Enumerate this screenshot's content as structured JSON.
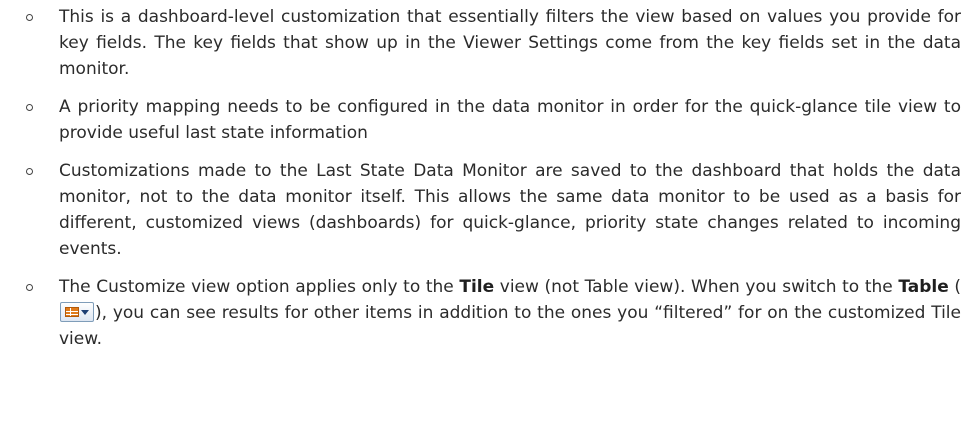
{
  "bullets": [
    {
      "text": "This is a dashboard-level customization that essentially filters the view based on values you provide for key fields. The key fields that show up in the Viewer Settings come from the key fields set in the data monitor."
    },
    {
      "text": "A priority mapping needs to be configured in the data monitor in order for the quick-glance tile view to provide useful last state information"
    },
    {
      "text": "Customizations made to the Last State Data Monitor are saved to the dashboard that holds the data monitor, not to the data monitor itself. This allows the same data monitor to be used as a basis for different, customized views (dashboards) for quick-glance, priority state changes related to incoming events."
    },
    {
      "part1": "The Customize view option applies only to the ",
      "tile": "Tile",
      "part2": " view (not Table view). When you switch to the ",
      "table": "Table",
      "part3": " (",
      "icon": "table-view-dropdown-icon",
      "part4": "), you can see results for other items in addition to the ones you “filtered” for on the customized Tile view."
    }
  ]
}
